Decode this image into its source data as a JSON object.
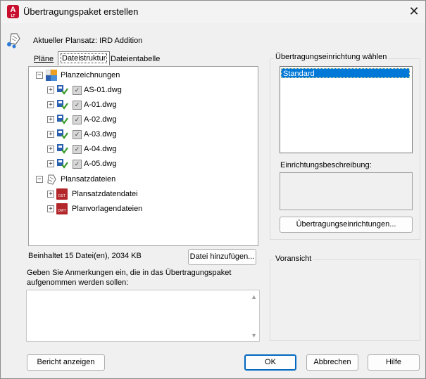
{
  "window": {
    "title": "Übertragungspaket erstellen",
    "app_icon_letter": "A",
    "app_icon_sub": "LT",
    "close_glyph": "✕"
  },
  "header": {
    "current_set_label": "Aktueller Plansatz: IRD Addition"
  },
  "tabs": [
    {
      "label": "Pläne",
      "active": false
    },
    {
      "label": "Dateistruktur",
      "active": true
    },
    {
      "label": "Dateientabelle",
      "active": false
    }
  ],
  "tree": {
    "root1": {
      "label": "Planzeichnungen",
      "expander": "−",
      "icon": "sheet-set-drawings-icon"
    },
    "drawings": [
      {
        "label": "AS-01.dwg",
        "checked": true
      },
      {
        "label": "A-01.dwg",
        "checked": true
      },
      {
        "label": "A-02.dwg",
        "checked": true
      },
      {
        "label": "A-03.dwg",
        "checked": true
      },
      {
        "label": "A-04.dwg",
        "checked": true
      },
      {
        "label": "A-05.dwg",
        "checked": true
      }
    ],
    "root2": {
      "label": "Plansatzdateien",
      "expander": "−",
      "icon": "sheet-set-files-icon"
    },
    "files": [
      {
        "label": "Plansatzdatendatei",
        "badge": "DST"
      },
      {
        "label": "Planvorlagendateien",
        "badge": "DWT"
      }
    ],
    "expander_plus": "+",
    "check_glyph": "✓"
  },
  "status": {
    "contains": "Beinhaltet 15 Datei(en), 2034 KB",
    "add_file_button": "Datei hinzufügen..."
  },
  "notes": {
    "label": "Geben Sie Anmerkungen ein, die in das Übertragungspaket aufgenommen werden sollen:",
    "value": "",
    "scroll_up": "▲",
    "scroll_down": "▼"
  },
  "transmittal_setup": {
    "group_label": "Übertragungseinrichtung wählen",
    "items": [
      "Standard"
    ],
    "selected": "Standard",
    "description_label": "Einrichtungsbeschreibung:",
    "description": "",
    "setups_button": "Übertragungseinrichtungen..."
  },
  "preview": {
    "group_label": "Voransicht"
  },
  "footer": {
    "report_button": "Bericht anzeigen",
    "ok_button": "OK",
    "cancel_button": "Abbrechen",
    "help_button": "Hilfe"
  },
  "colors": {
    "selection": "#0078d7",
    "accent_border": "#0067c0",
    "app_red": "#c8102e",
    "badge_red": "#b3262a"
  }
}
